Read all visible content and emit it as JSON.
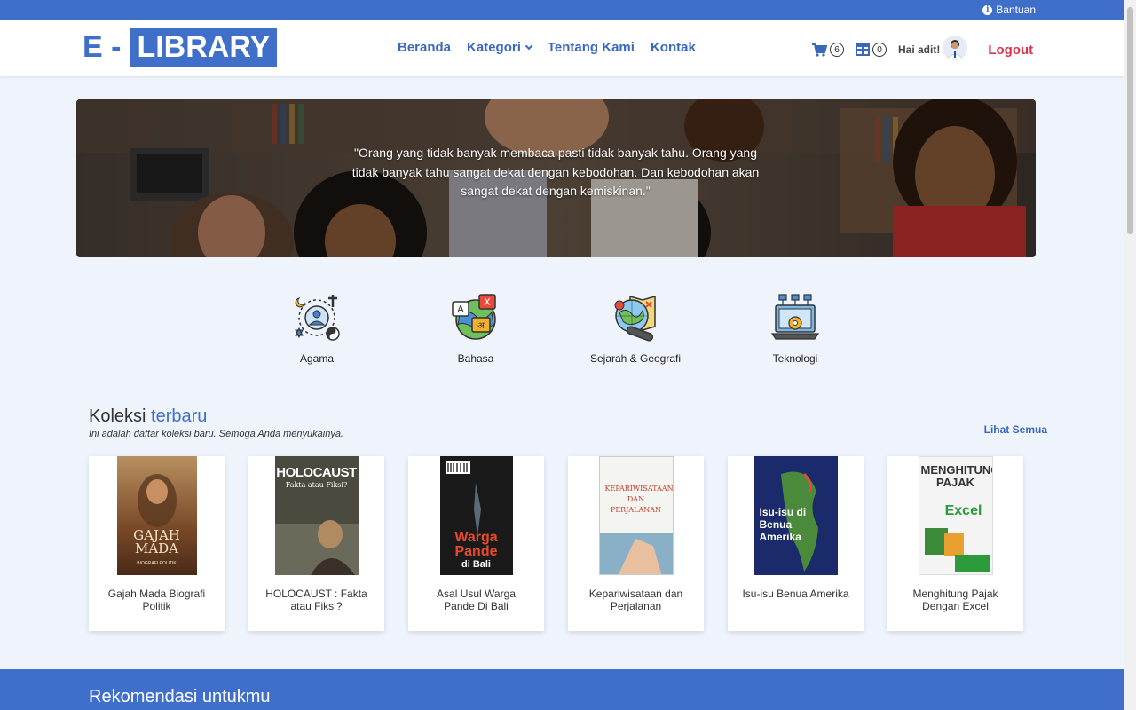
{
  "topbar": {
    "help_label": "Bantuan",
    "help_icon": "info-circle-icon"
  },
  "navbar": {
    "brand_prefix": "E -",
    "brand_main": "LIBRARY",
    "menu": [
      {
        "label": "Beranda"
      },
      {
        "label": "Kategori",
        "icon": "chevron-down-icon"
      },
      {
        "label": "Tentang Kami"
      },
      {
        "label": "Kontak"
      }
    ],
    "cart_count": "6",
    "collection_count": "0",
    "greeting": "Hai adit!",
    "logout_label": "Logout"
  },
  "hero": {
    "quote": "\"Orang yang tidak banyak membaca pasti tidak banyak tahu. Orang yang tidak banyak tahu sangat dekat dengan kebodohan. Dan kebodohan akan sangat dekat dengan kemiskinan.\""
  },
  "categories": [
    {
      "label": "Agama",
      "icon": "religion-icon"
    },
    {
      "label": "Bahasa",
      "icon": "language-icon"
    },
    {
      "label": "Sejarah & Geografi",
      "icon": "history-geography-icon"
    },
    {
      "label": "Teknologi",
      "icon": "technology-icon"
    }
  ],
  "latest": {
    "title_prefix": "Koleksi",
    "title_accent": "terbaru",
    "subtitle": "Ini adalah daftar koleksi baru. Semoga Anda menyukainya.",
    "see_all": "Lihat Semua",
    "books": [
      {
        "title": "Gajah Mada Biografi Politik",
        "cover_text": "GAJAH MADA",
        "cover_sub": "BIOGRAFI POLITIK"
      },
      {
        "title": "HOLOCAUST : Fakta atau Fiksi?",
        "cover_text": "HOLOCAUST",
        "cover_sub": "Fakta atau Fiksi?"
      },
      {
        "title": "Asal Usul Warga Pande Di Bali",
        "cover_text": "Warga Pande",
        "cover_sub": "di Bali"
      },
      {
        "title": "Kepariwisataan dan Perjalanan",
        "cover_text": "KEPARIWISATAAN DAN PERJALANAN",
        "cover_sub": ""
      },
      {
        "title": "Isu-isu Benua Amerika",
        "cover_text": "Isu-isu di Benua Amerika",
        "cover_sub": ""
      },
      {
        "title": "Menghitung Pajak Dengan Excel",
        "cover_text": "MENGHITUNG PAJAK",
        "cover_sub": "Excel"
      }
    ]
  },
  "recommend": {
    "title": "Rekomendasi untukmu"
  },
  "colors": {
    "primary": "#3f6fc8",
    "logout": "#d9344a",
    "background": "#eef3fc"
  }
}
